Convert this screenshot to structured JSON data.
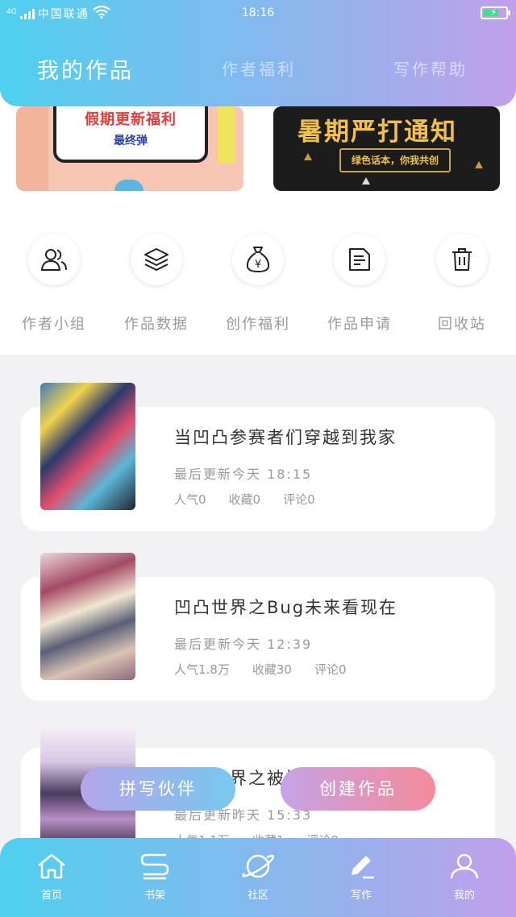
{
  "status_bar": {
    "signal": "4G",
    "carrier": "中国联通",
    "time": "18:16",
    "battery_level": 0.7
  },
  "header": {
    "tabs": [
      {
        "label": "我的作品",
        "active": true
      },
      {
        "label": "作者福利",
        "active": false
      },
      {
        "label": "写作帮助",
        "active": false
      }
    ]
  },
  "banners": [
    {
      "title": "假期更新福利",
      "subtitle": "最终弹"
    },
    {
      "title": "暑期严打通知",
      "subtitle": "绿色话本，你我共创"
    }
  ],
  "quick_actions": [
    {
      "label": "作者小组",
      "icon": "people-icon"
    },
    {
      "label": "作品数据",
      "icon": "layers-icon"
    },
    {
      "label": "创作福利",
      "icon": "money-bag-icon"
    },
    {
      "label": "作品申请",
      "icon": "document-icon"
    },
    {
      "label": "回收站",
      "icon": "trash-icon"
    }
  ],
  "works": [
    {
      "title": "当凹凸参赛者们穿越到我家",
      "updated": "最后更新今天 18:15",
      "popularity": "人气0",
      "favorites": "收藏0",
      "comments": "评论0"
    },
    {
      "title": "凹凸世界之Bug未来看现在",
      "updated": "最后更新今天 12:39",
      "popularity": "人气1.8万",
      "favorites": "收藏30",
      "comments": "评论0"
    },
    {
      "title": "凹凸世界之被惊",
      "updated": "最后更新昨天 15:33",
      "popularity": "人气1.1万",
      "favorites": "收藏1",
      "comments": "评论0"
    }
  ],
  "floating_buttons": {
    "partner": "拼写伙伴",
    "create": "创建作品"
  },
  "bottom_nav": [
    {
      "label": "首页",
      "icon": "home-icon"
    },
    {
      "label": "书架",
      "icon": "bookshelf-icon"
    },
    {
      "label": "社区",
      "icon": "planet-icon"
    },
    {
      "label": "写作",
      "icon": "pen-icon"
    },
    {
      "label": "我的",
      "icon": "user-icon"
    }
  ],
  "colors": {
    "header_gradient_start": "#4fd0ee",
    "header_gradient_end": "#c1a0ea",
    "create_button": "#f58a9b"
  }
}
